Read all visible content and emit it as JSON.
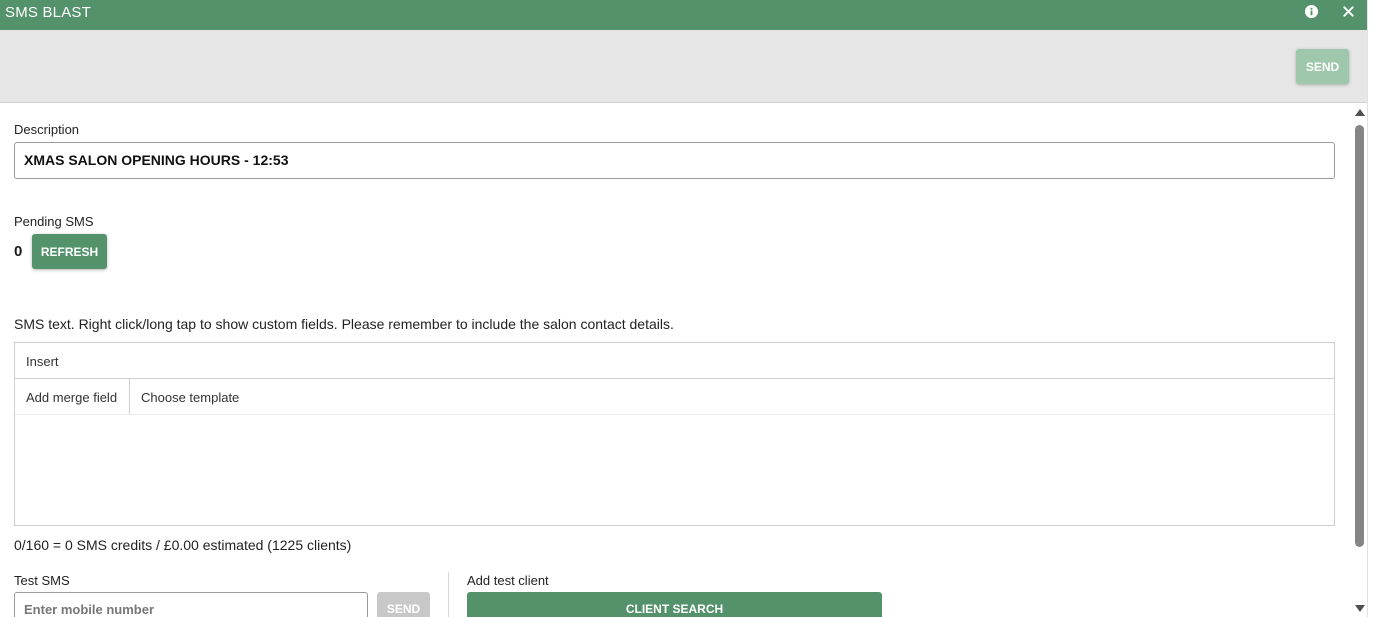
{
  "window": {
    "title": "SMS BLAST",
    "info_icon": "info-icon",
    "close_icon": "close-icon",
    "accent_color": "#53926a"
  },
  "actionbar": {
    "send_label": "SEND"
  },
  "description": {
    "label": "Description",
    "value": "XMAS SALON OPENING HOURS -  12:53"
  },
  "pending": {
    "label": "Pending SMS",
    "count": "0",
    "refresh_label": "REFRESH"
  },
  "sms_text": {
    "label": "SMS text. Right click/long tap to show custom fields. Please remember to include the salon contact details.",
    "menu_insert": "Insert",
    "toolbar_merge": "Add merge field",
    "toolbar_template": "Choose template",
    "content": ""
  },
  "credits": {
    "summary": "0/160 = 0 SMS credits / £0.00 estimated (1225 clients)"
  },
  "test_sms": {
    "label": "Test SMS",
    "placeholder": "Enter mobile number",
    "send_label": "SEND"
  },
  "add_test_client": {
    "label": "Add test client",
    "search_label": "CLIENT SEARCH"
  }
}
